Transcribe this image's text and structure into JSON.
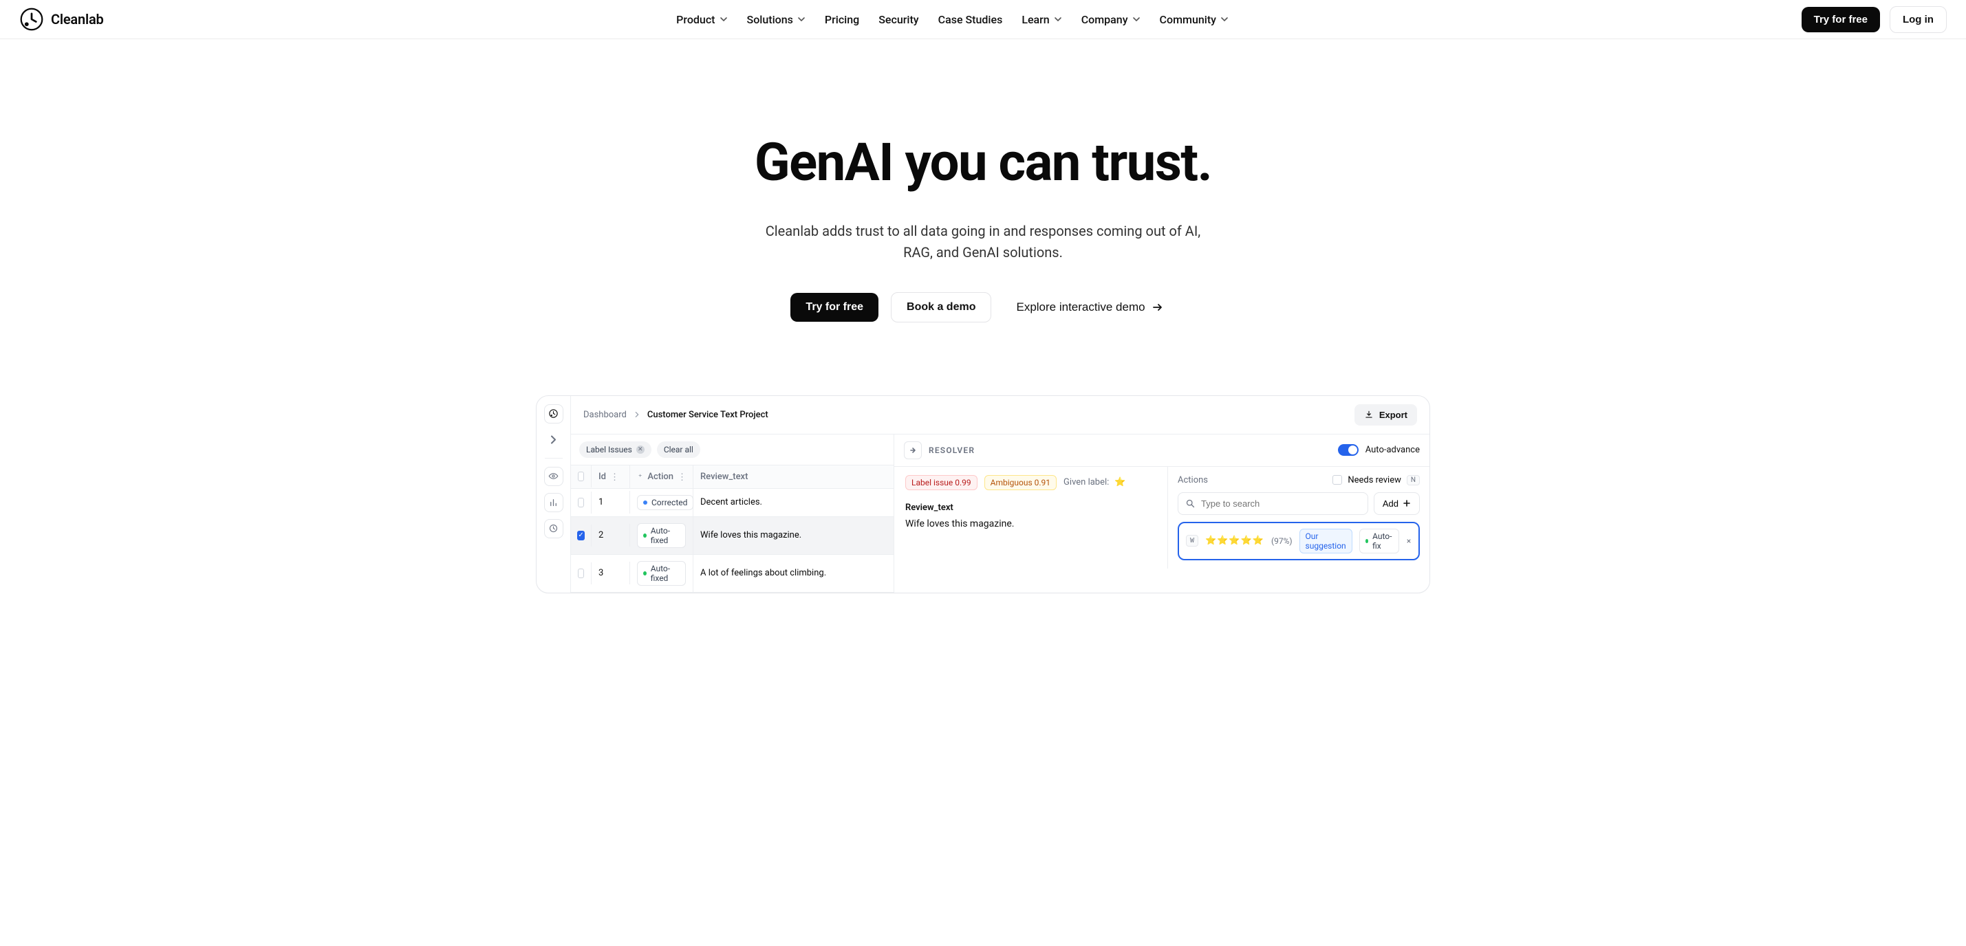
{
  "brand": {
    "name": "Cleanlab"
  },
  "nav": {
    "items": [
      {
        "label": "Product",
        "hasDropdown": true
      },
      {
        "label": "Solutions",
        "hasDropdown": true
      },
      {
        "label": "Pricing",
        "hasDropdown": false
      },
      {
        "label": "Security",
        "hasDropdown": false
      },
      {
        "label": "Case Studies",
        "hasDropdown": false
      },
      {
        "label": "Learn",
        "hasDropdown": true
      },
      {
        "label": "Company",
        "hasDropdown": true
      },
      {
        "label": "Community",
        "hasDropdown": true
      }
    ],
    "cta_primary": "Try for free",
    "cta_secondary": "Log in"
  },
  "hero": {
    "headline": "GenAI you can trust.",
    "sub": "Cleanlab adds trust to all data going in and responses coming out of AI, RAG, and GenAI solutions.",
    "btn_primary": "Try for free",
    "btn_secondary": "Book a demo",
    "btn_ghost": "Explore interactive demo"
  },
  "app": {
    "breadcrumb": {
      "root": "Dashboard",
      "current": "Customer Service Text Project"
    },
    "export": "Export",
    "filters": {
      "chip": "Label Issues",
      "clear": "Clear all"
    },
    "table": {
      "headers": {
        "id": "Id",
        "action": "Action",
        "review": "Review_text"
      },
      "rows": [
        {
          "id": "1",
          "action": "Corrected",
          "dot": "blue",
          "text": "Decent articles.",
          "checked": false
        },
        {
          "id": "2",
          "action": "Auto-fixed",
          "dot": "green",
          "text": "Wife loves this magazine.",
          "checked": true
        },
        {
          "id": "3",
          "action": "Auto-fixed",
          "dot": "green",
          "text": "A lot of feelings about climbing.",
          "checked": false
        }
      ]
    },
    "resolver": {
      "title": "RESOLVER",
      "auto_advance": "Auto-advance",
      "tags": {
        "label_issue": "Label issue 0.99",
        "ambiguous": "Ambiguous 0.91"
      },
      "given_label": "Given label:",
      "given_star": "⭐",
      "field_name": "Review_text",
      "field_value": "Wife loves this magazine.",
      "actions_label": "Actions",
      "needs_review": "Needs review",
      "needs_key": "N",
      "search_placeholder": "Type to search",
      "add": "Add",
      "suggest": {
        "key": "W",
        "stars": "⭐⭐⭐⭐⭐",
        "pct": "(97%)",
        "chip": "Our suggestion",
        "autofix": "Auto-fix"
      }
    }
  }
}
